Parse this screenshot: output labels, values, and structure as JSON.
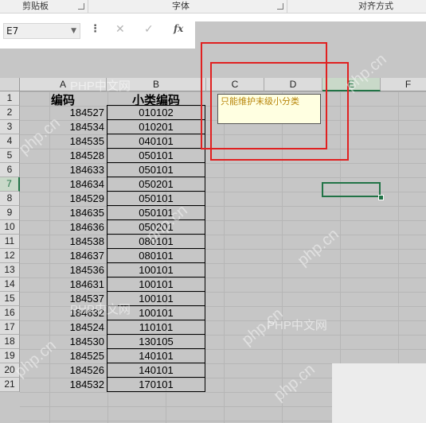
{
  "ribbon": {
    "groups": [
      "剪贴板",
      "字体",
      "对齐方式"
    ]
  },
  "formula_bar": {
    "name_box": "E7",
    "menu_dots": "⋮",
    "cancel_glyph": "✕",
    "enter_glyph": "✓",
    "fx": "fx"
  },
  "columns": [
    "A",
    "B",
    "C",
    "D",
    "E",
    "F"
  ],
  "rows": [
    "1",
    "2",
    "3",
    "4",
    "5",
    "6",
    "7",
    "8",
    "9",
    "10",
    "11",
    "12",
    "13",
    "14",
    "15",
    "16",
    "17",
    "18",
    "19",
    "20",
    "21"
  ],
  "sheet": {
    "header_a": "编码",
    "header_b": "小类编码",
    "data": [
      [
        "184527",
        "010102"
      ],
      [
        "184534",
        "010201"
      ],
      [
        "184535",
        "040101"
      ],
      [
        "184528",
        "050101"
      ],
      [
        "184633",
        "050101"
      ],
      [
        "184634",
        "050201"
      ],
      [
        "184529",
        "050101"
      ],
      [
        "184635",
        "050101"
      ],
      [
        "184636",
        "050201"
      ],
      [
        "184538",
        "080101"
      ],
      [
        "184637",
        "080101"
      ],
      [
        "184536",
        "100101"
      ],
      [
        "184631",
        "100101"
      ],
      [
        "184537",
        "100101"
      ],
      [
        "184632",
        "100101"
      ],
      [
        "184524",
        "110101"
      ],
      [
        "184530",
        "130105"
      ],
      [
        "184525",
        "140101"
      ],
      [
        "184526",
        "140101"
      ],
      [
        "184532",
        "170101"
      ]
    ]
  },
  "comment": {
    "text": "只能维护末级小分类"
  },
  "selection": {
    "cell": "E7",
    "accent": "#217346"
  },
  "watermarks": [
    "PHP中文网",
    "php.cn"
  ],
  "colors": {
    "annotation_red": "#e02020",
    "comment_bg": "#ffffe1",
    "comment_text": "#b8860b"
  }
}
